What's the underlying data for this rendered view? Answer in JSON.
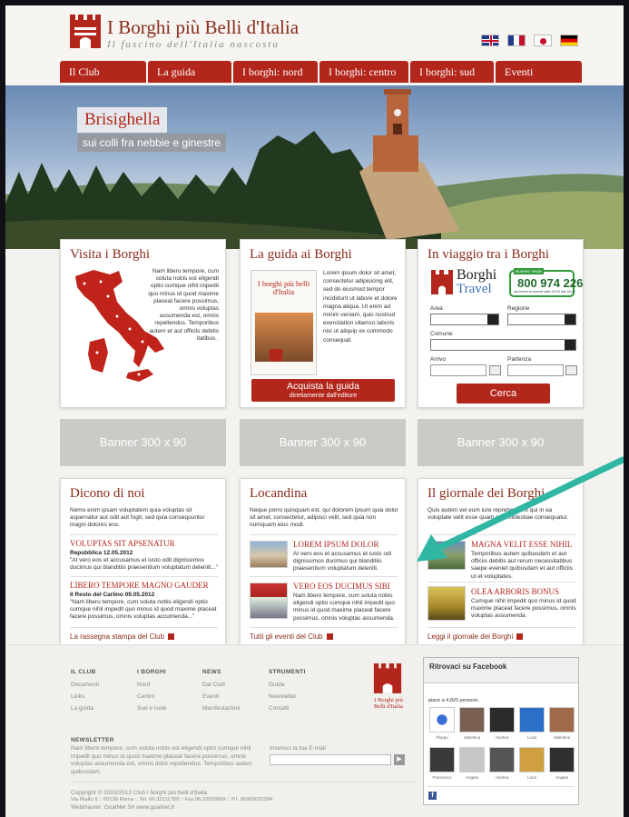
{
  "header": {
    "brand_title": "I Borghi più Belli d'Italia",
    "brand_tagline": "Il fascino dell'Italia nascosta"
  },
  "nav": [
    "Il Club",
    "La guida",
    "I borghi: nord",
    "I borghi: centro",
    "I borghi: sud",
    "Eventi"
  ],
  "hero": {
    "title": "Brisighella",
    "subtitle": "sui colli fra nebbie e ginestre"
  },
  "visita": {
    "title": "Visita i Borghi",
    "text": "Nam libero tempore, cum soluta nobis est eligendi optio cumque nihil impedit quo minus id quod maxime placeat facere possimus, omnis voluptas assumenda est, omnis repellendus. Temporibus autem et aut officiis debitis itatibus ."
  },
  "guida": {
    "title": "La guida ai Borghi",
    "book_title": "I borghi più belli d'Italia",
    "text": "Lorem ipsum dolor sit amet, consectetur adipisicing elit, sed do eiusmod tempor incididunt ut labore et dolore magna aliqua. Ut enim ad minim veniam, quis nostrud exercitation ullamco laboris nisi ut aliquip ex commodo consequat.",
    "btn_main": "Acquista la guida",
    "btn_sub": "direttamente dall'editore"
  },
  "viaggio": {
    "title": "In viaggio tra i Borghi",
    "brand_top": "Borghi",
    "brand_bottom": "Travel",
    "phone_label": "Numero Verde",
    "phone": "800 974 226",
    "phone_note": "dal lunedì al venerdì dalle 09:00 alle 18:00",
    "area": "Area",
    "regione": "Regione",
    "comune": "Comune",
    "arrivo": "Arrivo",
    "partenza": "Partenza",
    "search": "Cerca"
  },
  "banners": [
    "Banner 300 x 90",
    "Banner 300 x 90",
    "Banner 300 x 90"
  ],
  "dicono": {
    "title": "Dicono di noi",
    "intro": "Nemo enim ipsam voluptatem quia voluptas sit aspernatur aut odit aut fugit, sed quia consequuntur magni dolores eos.",
    "items": [
      {
        "head": "VOLUPTAS SIT APSENATUR",
        "source": "Repubblica 12.05.2012",
        "text": "\"At vero eos et accusamus et iusto odit dignissimos ducimus qui blanditiis praesentium voluptatum deleniti...\""
      },
      {
        "head": "LIBERO TEMPORE MAGNO GAUDER",
        "source": "Il Resto del Carlino 09.05.2012",
        "text": "\"Nam libero tempore, cum soluta nobis eligendi optio cumque nihil impedit quo minus id quod maxime placeat facere possimus, omnis voluptas accumenda...\""
      }
    ],
    "more": "La rassegna stampa del Club"
  },
  "locandina": {
    "title": "Locandina",
    "intro": "Neque porro quisquam est, qui dolorem ipsum quia dolor sit amet, consectetur, adipisci velit, sed quia non numquam eius modi.",
    "items": [
      {
        "head": "LOREM IPSUM DOLOR",
        "text": "At vero eos et accusamus et iusto odi dignissimos ducimus qui blanditiis praesentium voluptatum deleniti."
      },
      {
        "head": "VERO EOS DUCIMUS SIBI",
        "text": "Nam libero tempore, cum soluta nobis eligendi optio cumque nihil impedit quo minus id quod maxime placeat facere possimus, omnis voluptas assumenda."
      }
    ],
    "more": "Tutti gli eventi del Club"
  },
  "giornale": {
    "title": "Il giornale dei Borghi",
    "intro": "Quis autem vel eum iure reprehenderit qui in ea voluptate velit esse quam nihil molestiae consequatur.",
    "items": [
      {
        "head": "MAGNA VELIT ESSE NIHIL",
        "text": "Temporibus autem quibusdam et aut officiis debitis aut rerum necessitatibus saepe eveniet quibusdam et aut officiis ut et voluptates."
      },
      {
        "head": "OLEA ARBORIS BONUS",
        "text": "Cumque nihil impedit quo minus id quod maxime placeat facere possimus, omnis voluptas assumenda."
      }
    ],
    "more": "Leggi il giornale dei Borghi"
  },
  "footer": {
    "cols": [
      {
        "title": "IL CLUB",
        "items": [
          "Documenti",
          "Links",
          "La guida"
        ]
      },
      {
        "title": "I BORGHI",
        "items": [
          "Nord",
          "Centro",
          "Sud e Isole"
        ]
      },
      {
        "title": "NEWS",
        "items": [
          "Dal Club",
          "Eventi",
          "Manifestazioni"
        ]
      },
      {
        "title": "STRUMENTI",
        "items": [
          "Guida",
          "Newsletter",
          "Contatti"
        ]
      }
    ],
    "logo_text": "I Borghi più Belli d'Italia",
    "newsletter_title": "NEWSLETTER",
    "newsletter_text": "Nam libero tempore, cum soluta nobis est eligendi optio cumque nihil impedit quo minus id quod maxime placeat facere possimus, omnis voluptas assumenda est, omnis dolor repellendus. Temporibus autem quibusdam.",
    "email_label": "Inserisci la tua E-mail",
    "copyright": "Copyright © 2003/2012 Club I borghi più belli d'Italia",
    "address": "Via Rialto 6 :: 00136 Roma :: Tel. 06.32111789 :: Fax 06.32503969 :: P.I. 06982031004",
    "webmaster": "Webmaster: GoalNet Srl www.goalnet.it"
  },
  "facebook": {
    "title": "Ritrovaci su Facebook",
    "count": "piace a 4,825 persone.",
    "people": [
      "Filippo",
      "Valentina",
      "Andrea",
      "Lucia",
      "Valentina",
      "Francesco",
      "Angela",
      "Andrea",
      "Luca",
      "Angela"
    ]
  }
}
